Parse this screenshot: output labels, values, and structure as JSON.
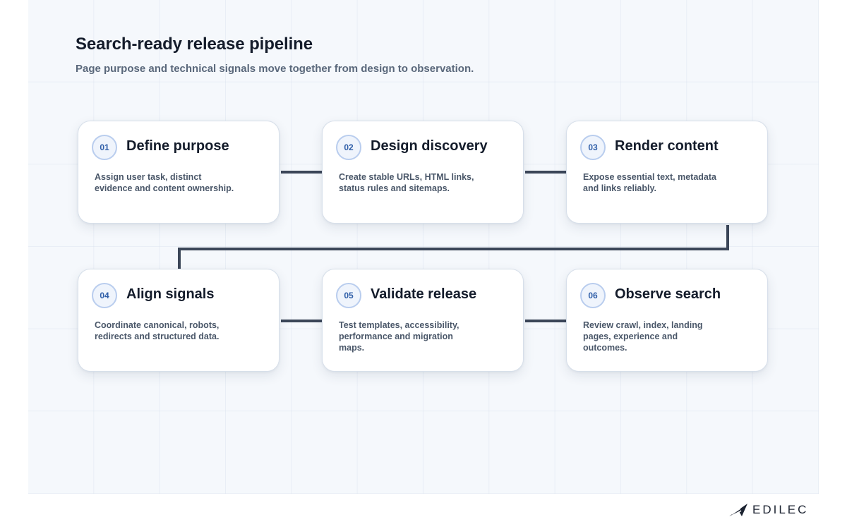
{
  "header": {
    "title": "Search-ready release pipeline",
    "subtitle": "Page purpose and technical signals move together from design to observation."
  },
  "steps": [
    {
      "number": "01",
      "title": "Define purpose",
      "description": "Assign user task, distinct evidence and content ownership."
    },
    {
      "number": "02",
      "title": "Design discovery",
      "description": "Create stable URLs, HTML links, status rules and sitemaps."
    },
    {
      "number": "03",
      "title": "Render content",
      "description": "Expose essential text, metadata and links reliably."
    },
    {
      "number": "04",
      "title": "Align signals",
      "description": "Coordinate canonical, robots, redirects and structured data."
    },
    {
      "number": "05",
      "title": "Validate release",
      "description": "Test templates, accessibility, performance and migration maps."
    },
    {
      "number": "06",
      "title": "Observe search",
      "description": "Review crawl, index, landing pages, experience and outcomes."
    }
  ],
  "brand": {
    "logo_text": "EDILEC",
    "logo_icon": "edilec-logo-mark"
  },
  "colors": {
    "canvas": "#f5f8fc",
    "connector": "#3b4658",
    "badge_border": "#b9cdee",
    "badge_text": "#2f5ea8",
    "title_text": "#141c2b",
    "body_text": "#4a5769"
  }
}
